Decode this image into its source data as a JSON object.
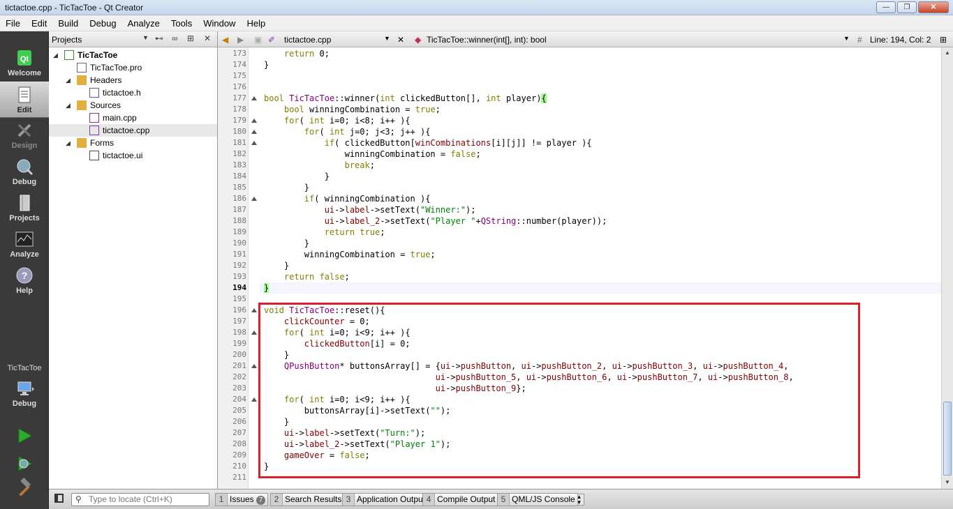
{
  "window": {
    "title": "tictactoe.cpp - TicTacToe - Qt Creator"
  },
  "menu": [
    "File",
    "Edit",
    "Build",
    "Debug",
    "Analyze",
    "Tools",
    "Window",
    "Help"
  ],
  "modes": [
    {
      "label": "Welcome",
      "icon": "qt-logo-icon"
    },
    {
      "label": "Edit",
      "icon": "edit-document-icon"
    },
    {
      "label": "Design",
      "icon": "design-pencil-icon"
    },
    {
      "label": "Debug",
      "icon": "debug-bug-icon"
    },
    {
      "label": "Projects",
      "icon": "projects-icon"
    },
    {
      "label": "Analyze",
      "icon": "analyze-chart-icon"
    },
    {
      "label": "Help",
      "icon": "help-question-icon"
    }
  ],
  "kit": {
    "project": "TicTacToe",
    "config": "Debug"
  },
  "projects": {
    "selector_label": "Projects",
    "tree": [
      {
        "label": "TicTacToe",
        "level": 0,
        "type": "project"
      },
      {
        "label": "TicTacToe.pro",
        "level": 1,
        "type": "pro"
      },
      {
        "label": "Headers",
        "level": 1,
        "type": "folder"
      },
      {
        "label": "tictactoe.h",
        "level": 2,
        "type": "header"
      },
      {
        "label": "Sources",
        "level": 1,
        "type": "folder"
      },
      {
        "label": "main.cpp",
        "level": 2,
        "type": "cpp"
      },
      {
        "label": "tictactoe.cpp",
        "level": 2,
        "type": "cpp"
      },
      {
        "label": "Forms",
        "level": 1,
        "type": "folder"
      },
      {
        "label": "tictactoe.ui",
        "level": 2,
        "type": "ui"
      }
    ]
  },
  "editor": {
    "file": "tictactoe.cpp",
    "symbol": "TicTacToe::winner(int[], int): bool",
    "position": "Line: 194, Col: 2",
    "current_line": 194,
    "first_line": 173,
    "lines": [
      [
        [
          "    "
        ],
        [
          "return",
          "k"
        ],
        [
          " 0;"
        ]
      ],
      [
        [
          "}"
        ]
      ],
      [
        [
          ""
        ]
      ],
      [
        [
          ""
        ]
      ],
      [
        [
          "bool",
          "k"
        ],
        [
          " "
        ],
        [
          "TicTacToe",
          "c"
        ],
        [
          "::winner("
        ],
        [
          "int",
          "k"
        ],
        [
          " clickedButton[], "
        ],
        [
          "int",
          "k"
        ],
        [
          " player)"
        ],
        [
          "{",
          "b"
        ]
      ],
      [
        [
          "    "
        ],
        [
          "bool",
          "k"
        ],
        [
          " winningCombination = "
        ],
        [
          "true",
          "k"
        ],
        [
          ";"
        ]
      ],
      [
        [
          "    "
        ],
        [
          "for",
          "k"
        ],
        [
          "( "
        ],
        [
          "int",
          "k"
        ],
        [
          " i=0; i<8; i++ ){"
        ]
      ],
      [
        [
          "        "
        ],
        [
          "for",
          "k"
        ],
        [
          "( "
        ],
        [
          "int",
          "k"
        ],
        [
          " j=0; j<3; j++ ){"
        ]
      ],
      [
        [
          "            "
        ],
        [
          "if",
          "k"
        ],
        [
          "( clickedButton["
        ],
        [
          "winCombinations",
          "v"
        ],
        [
          "[i][j]] != player ){"
        ]
      ],
      [
        [
          "                winningCombination = "
        ],
        [
          "false",
          "k"
        ],
        [
          ";"
        ]
      ],
      [
        [
          "                "
        ],
        [
          "break",
          "k"
        ],
        [
          ";"
        ]
      ],
      [
        [
          "            }"
        ]
      ],
      [
        [
          "        }"
        ]
      ],
      [
        [
          "        "
        ],
        [
          "if",
          "k"
        ],
        [
          "( winningCombination ){"
        ]
      ],
      [
        [
          "            "
        ],
        [
          "ui",
          "v"
        ],
        [
          "->"
        ],
        [
          "label",
          "v"
        ],
        [
          "->setText("
        ],
        [
          "\"Winner:\"",
          "s"
        ],
        [
          ");"
        ]
      ],
      [
        [
          "            "
        ],
        [
          "ui",
          "v"
        ],
        [
          "->"
        ],
        [
          "label_2",
          "v"
        ],
        [
          "->setText("
        ],
        [
          "\"Player \"",
          "s"
        ],
        [
          "+"
        ],
        [
          "QString",
          "c"
        ],
        [
          "::number(player));"
        ]
      ],
      [
        [
          "            "
        ],
        [
          "return",
          "k"
        ],
        [
          " "
        ],
        [
          "true",
          "k"
        ],
        [
          ";"
        ]
      ],
      [
        [
          "        }"
        ]
      ],
      [
        [
          "        winningCombination = "
        ],
        [
          "true",
          "k"
        ],
        [
          ";"
        ]
      ],
      [
        [
          "    }"
        ]
      ],
      [
        [
          "    "
        ],
        [
          "return",
          "k"
        ],
        [
          " "
        ],
        [
          "false",
          "k"
        ],
        [
          ";"
        ]
      ],
      [
        [
          "}",
          "b"
        ]
      ],
      [
        [
          ""
        ]
      ],
      [
        [
          "void",
          "k"
        ],
        [
          " "
        ],
        [
          "TicTacToe",
          "c"
        ],
        [
          "::reset(){"
        ]
      ],
      [
        [
          "    "
        ],
        [
          "clickCounter",
          "v"
        ],
        [
          " = 0;"
        ]
      ],
      [
        [
          "    "
        ],
        [
          "for",
          "k"
        ],
        [
          "( "
        ],
        [
          "int",
          "k"
        ],
        [
          " i=0; i<9; i++ ){"
        ]
      ],
      [
        [
          "        "
        ],
        [
          "clickedButton",
          "v"
        ],
        [
          "[i] = 0;"
        ]
      ],
      [
        [
          "    }"
        ]
      ],
      [
        [
          "    "
        ],
        [
          "QPushButton",
          "c"
        ],
        [
          "* buttonsArray[] = {"
        ],
        [
          "ui",
          "v"
        ],
        [
          "->"
        ],
        [
          "pushButton",
          "v"
        ],
        [
          ", "
        ],
        [
          "ui",
          "v"
        ],
        [
          "->"
        ],
        [
          "pushButton_2",
          "v"
        ],
        [
          ", "
        ],
        [
          "ui",
          "v"
        ],
        [
          "->"
        ],
        [
          "pushButton_3",
          "v"
        ],
        [
          ", "
        ],
        [
          "ui",
          "v"
        ],
        [
          "->"
        ],
        [
          "pushButton_4",
          "v"
        ],
        [
          ","
        ]
      ],
      [
        [
          "                                  "
        ],
        [
          "ui",
          "v"
        ],
        [
          "->"
        ],
        [
          "pushButton_5",
          "v"
        ],
        [
          ", "
        ],
        [
          "ui",
          "v"
        ],
        [
          "->"
        ],
        [
          "pushButton_6",
          "v"
        ],
        [
          ", "
        ],
        [
          "ui",
          "v"
        ],
        [
          "->"
        ],
        [
          "pushButton_7",
          "v"
        ],
        [
          ", "
        ],
        [
          "ui",
          "v"
        ],
        [
          "->"
        ],
        [
          "pushButton_8",
          "v"
        ],
        [
          ","
        ]
      ],
      [
        [
          "                                  "
        ],
        [
          "ui",
          "v"
        ],
        [
          "->"
        ],
        [
          "pushButton_9",
          "v"
        ],
        [
          "};"
        ]
      ],
      [
        [
          "    "
        ],
        [
          "for",
          "k"
        ],
        [
          "( "
        ],
        [
          "int",
          "k"
        ],
        [
          " i=0; i<9; i++ ){"
        ]
      ],
      [
        [
          "        buttonsArray[i]->setText("
        ],
        [
          "\"\"",
          "s"
        ],
        [
          ");"
        ]
      ],
      [
        [
          "    }"
        ]
      ],
      [
        [
          "    "
        ],
        [
          "ui",
          "v"
        ],
        [
          "->"
        ],
        [
          "label",
          "v"
        ],
        [
          "->setText("
        ],
        [
          "\"Turn:\"",
          "s"
        ],
        [
          ");"
        ]
      ],
      [
        [
          "    "
        ],
        [
          "ui",
          "v"
        ],
        [
          "->"
        ],
        [
          "label_2",
          "v"
        ],
        [
          "->setText("
        ],
        [
          "\"Player 1\"",
          "s"
        ],
        [
          ");"
        ]
      ],
      [
        [
          "    "
        ],
        [
          "gameOver",
          "v"
        ],
        [
          " = "
        ],
        [
          "false",
          "k"
        ],
        [
          ";"
        ]
      ],
      [
        [
          "}"
        ]
      ],
      [
        [
          ""
        ]
      ]
    ],
    "fold_lines": [
      177,
      179,
      180,
      181,
      186,
      196,
      198,
      201,
      204
    ]
  },
  "locator": {
    "placeholder": "Type to locate (Ctrl+K)"
  },
  "output_tabs": [
    {
      "num": "1",
      "label": "Issues",
      "badge": "7"
    },
    {
      "num": "2",
      "label": "Search Results"
    },
    {
      "num": "3",
      "label": "Application Output"
    },
    {
      "num": "4",
      "label": "Compile Output"
    },
    {
      "num": "5",
      "label": "QML/JS Console"
    }
  ],
  "colors": {
    "keyword": "#808000",
    "class": "#800080",
    "variable": "#800000",
    "string": "#008000",
    "brace_match": "#a0ff90",
    "highlight_box": "#d8202c"
  }
}
